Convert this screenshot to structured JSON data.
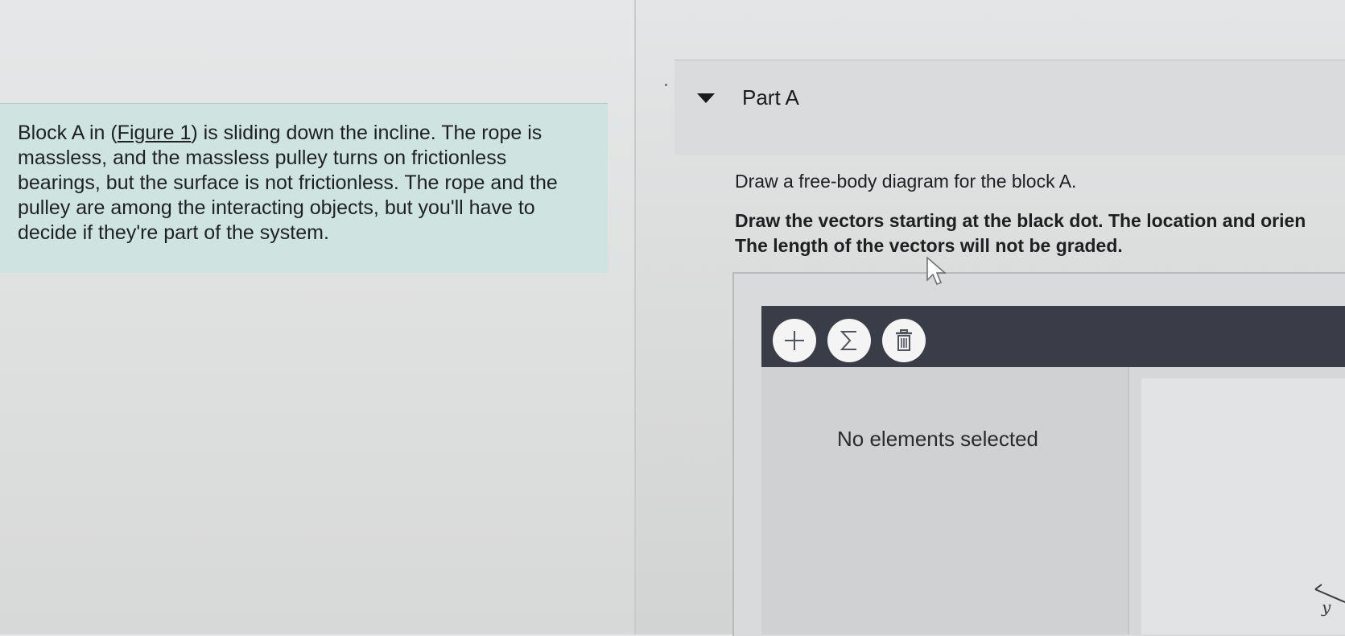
{
  "problem": {
    "text_before_link": "Block A in (",
    "link_text": "Figure 1",
    "text_after_link": ") is sliding down the incline. The rope is massless, and the massless pulley turns on frictionless bearings, but the surface is not frictionless. The rope and the pulley are among the interacting objects, but you'll have to decide if they're part of the system."
  },
  "part": {
    "title": "Part A",
    "caret_icon": "caret-down-icon"
  },
  "instructions": {
    "main": "Draw a free-body diagram for the block A.",
    "bold_line1": "Draw the vectors starting at the black dot. The location and orien",
    "bold_line2": "The length of the vectors will not be graded."
  },
  "tool": {
    "buttons": [
      {
        "name": "add-vector-button",
        "icon": "plus-icon"
      },
      {
        "name": "sum-vector-button",
        "icon": "sigma-icon"
      },
      {
        "name": "delete-button",
        "icon": "trash-icon"
      }
    ],
    "status": "No elements selected",
    "axis_label": "y"
  },
  "colors": {
    "problem_bg": "#cfe3e1",
    "toolbar_bg": "#3a3d48",
    "button_bg": "#f4f4f4"
  }
}
